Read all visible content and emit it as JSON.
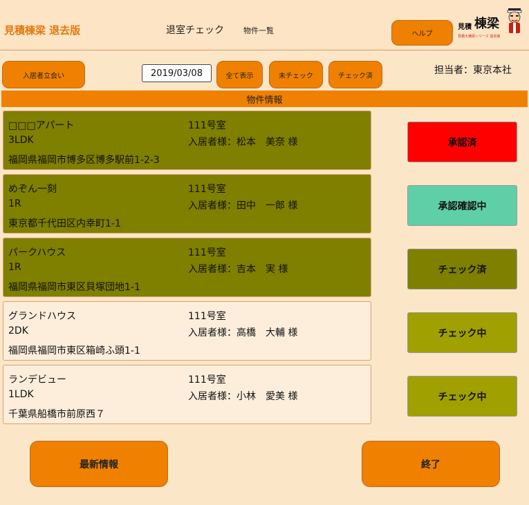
{
  "header": {
    "app_title": "見積棟梁 退去版",
    "screen_title": "退室チェック",
    "screen_subtitle": "物件一覧",
    "help_label": "ヘルプ",
    "logo": {
      "text_small": "見積",
      "text_large": "棟梁",
      "tagline": "見積大棟梁シリーズ 退去版"
    }
  },
  "toolbar": {
    "move_in_label": "入居者立会い",
    "date_value": "2019/03/08",
    "show_all_label": "全て表示",
    "unchecked_label": "未チェック",
    "checked_label": "チェック済",
    "person_in_charge": "担当者：東京本社"
  },
  "section_title": "物件情報",
  "properties": [
    {
      "name": "□□□アパート",
      "layout": "3LDK",
      "address": "福岡県福岡市博多区博多駅前1-2-3",
      "room": "111号室",
      "tenant": "入居者様：松本　美奈 様",
      "status_label": "承認済",
      "status_color": "#ff0000",
      "card_state": "done"
    },
    {
      "name": "めぞん一刻",
      "layout": "1R",
      "address": "東京都千代田区内幸町1-1",
      "room": "111号室",
      "tenant": "入居者様：田中　一郎 様",
      "status_label": "承認確認中",
      "status_color": "#5fcfa8",
      "card_state": "done"
    },
    {
      "name": "パークハウス",
      "layout": "1R",
      "address": "福岡県福岡市東区貝塚団地1-1",
      "room": "111号室",
      "tenant": "入居者様：吉本　実 様",
      "status_label": "チェック済",
      "status_color": "#7f7f00",
      "card_state": "done"
    },
    {
      "name": "グランドハウス",
      "layout": "2DK",
      "address": "福岡県福岡市東区箱崎ふ頭1-1",
      "room": "111号室",
      "tenant": "入居者様：高橋　大輔 様",
      "status_label": "チェック中",
      "status_color": "#a0a000",
      "card_state": "open"
    },
    {
      "name": "ランデビュー",
      "layout": "1LDK",
      "address": "千葉県船橋市前原西７",
      "room": "111号室",
      "tenant": "入居者様：小林　愛美 様",
      "status_label": "チェック中",
      "status_color": "#a0a000",
      "card_state": "open"
    }
  ],
  "footer": {
    "refresh_label": "最新情報",
    "exit_label": "終了"
  },
  "colors": {
    "accent": "#f08000",
    "background": "#fce6c8",
    "done_card": "#7f7f00"
  }
}
